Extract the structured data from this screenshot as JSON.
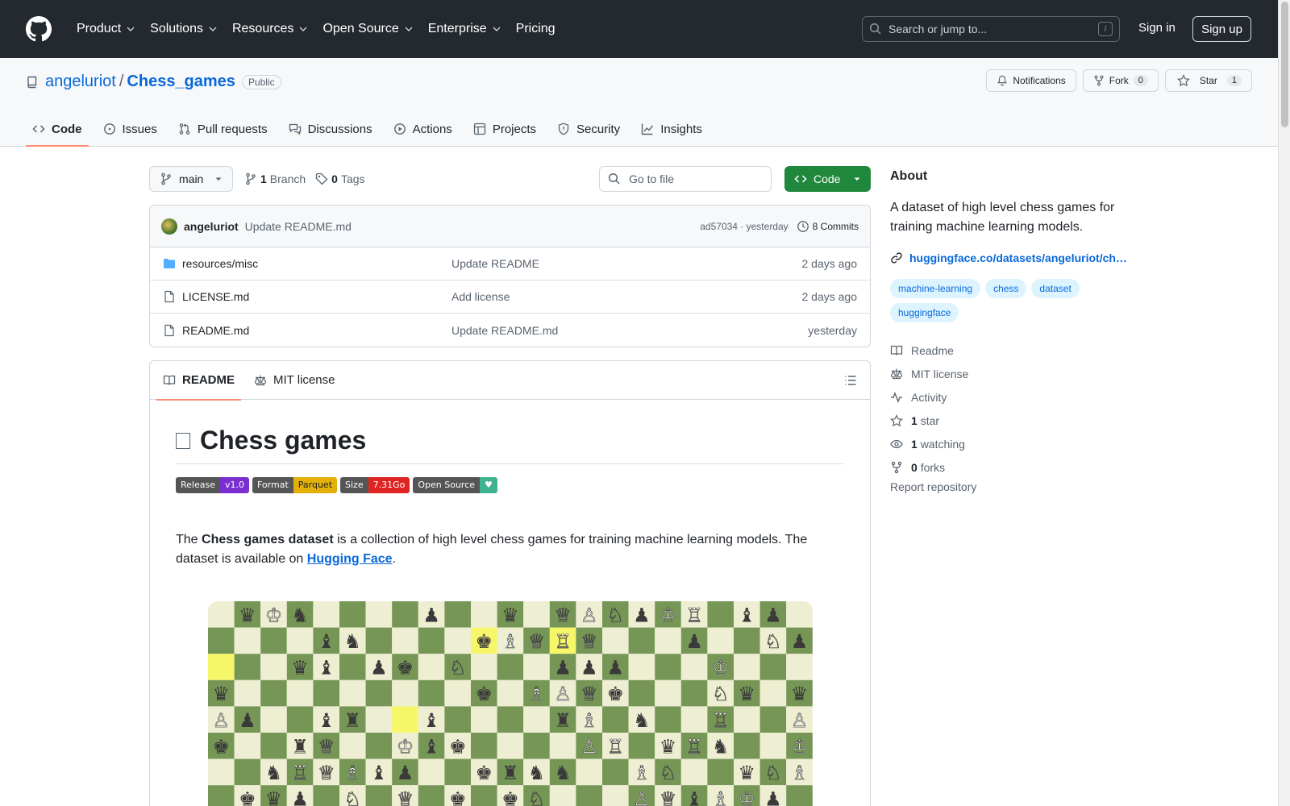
{
  "header": {
    "nav": [
      "Product",
      "Solutions",
      "Resources",
      "Open Source",
      "Enterprise",
      "Pricing"
    ],
    "search_placeholder": "Search or jump to...",
    "search_shortcut": "/",
    "signin": "Sign in",
    "signup": "Sign up"
  },
  "repo": {
    "owner": "angeluriot",
    "separator": "/",
    "name": "Chess_games",
    "visibility": "Public",
    "notifications": "Notifications",
    "fork_label": "Fork",
    "fork_count": "0",
    "star_label": "Star",
    "star_count": "1"
  },
  "tabs": [
    "Code",
    "Issues",
    "Pull requests",
    "Discussions",
    "Actions",
    "Projects",
    "Security",
    "Insights"
  ],
  "toolbar": {
    "branch": "main",
    "branch_count": "1",
    "branch_label": "Branch",
    "tag_count": "0",
    "tag_label": "Tags",
    "goto_placeholder": "Go to file",
    "code_button": "Code"
  },
  "latest_commit": {
    "author": "angeluriot",
    "message": "Update README.md",
    "hash_time": "ad57034 · yesterday",
    "commits": "8 Commits"
  },
  "files": [
    {
      "name": "resources/misc",
      "type": "folder",
      "message": "Update README",
      "date": "2 days ago"
    },
    {
      "name": "LICENSE.md",
      "type": "file",
      "message": "Add license",
      "date": "2 days ago"
    },
    {
      "name": "README.md",
      "type": "file",
      "message": "Update README.md",
      "date": "yesterday"
    }
  ],
  "readme": {
    "tab_readme": "README",
    "tab_license": "MIT license",
    "title": "Chess games",
    "shields": [
      {
        "left": "Release",
        "right": "v1.0",
        "color": "#7b2fd0"
      },
      {
        "left": "Format",
        "right": "Parquet",
        "color": "#e2b007"
      },
      {
        "left": "Size",
        "right": "7.31Go",
        "color": "#e02424"
      },
      {
        "left": "Open Source",
        "right": "♥",
        "color": "#3fb38f"
      }
    ],
    "intro_pre": "The ",
    "intro_bold": "Chess games dataset",
    "intro_mid": " is a collection of high level chess games for training machine learning models. The dataset is available on ",
    "intro_link": "Hugging Face",
    "intro_post": "."
  },
  "about": {
    "heading": "About",
    "description": "A dataset of high level chess games for training machine learning models.",
    "link": "huggingface.co/datasets/angeluriot/ch…",
    "topics": [
      "machine-learning",
      "chess",
      "dataset",
      "huggingface"
    ],
    "readme": "Readme",
    "license": "MIT license",
    "activity": "Activity",
    "stars_count": "1",
    "stars_label": "star",
    "watching_count": "1",
    "watching_label": "watching",
    "forks_count": "0",
    "forks_label": "forks",
    "report": "Report repository"
  },
  "colors": {
    "board_light": "#eeeed2",
    "board_dark": "#769656",
    "highlight": "#f6f669"
  }
}
